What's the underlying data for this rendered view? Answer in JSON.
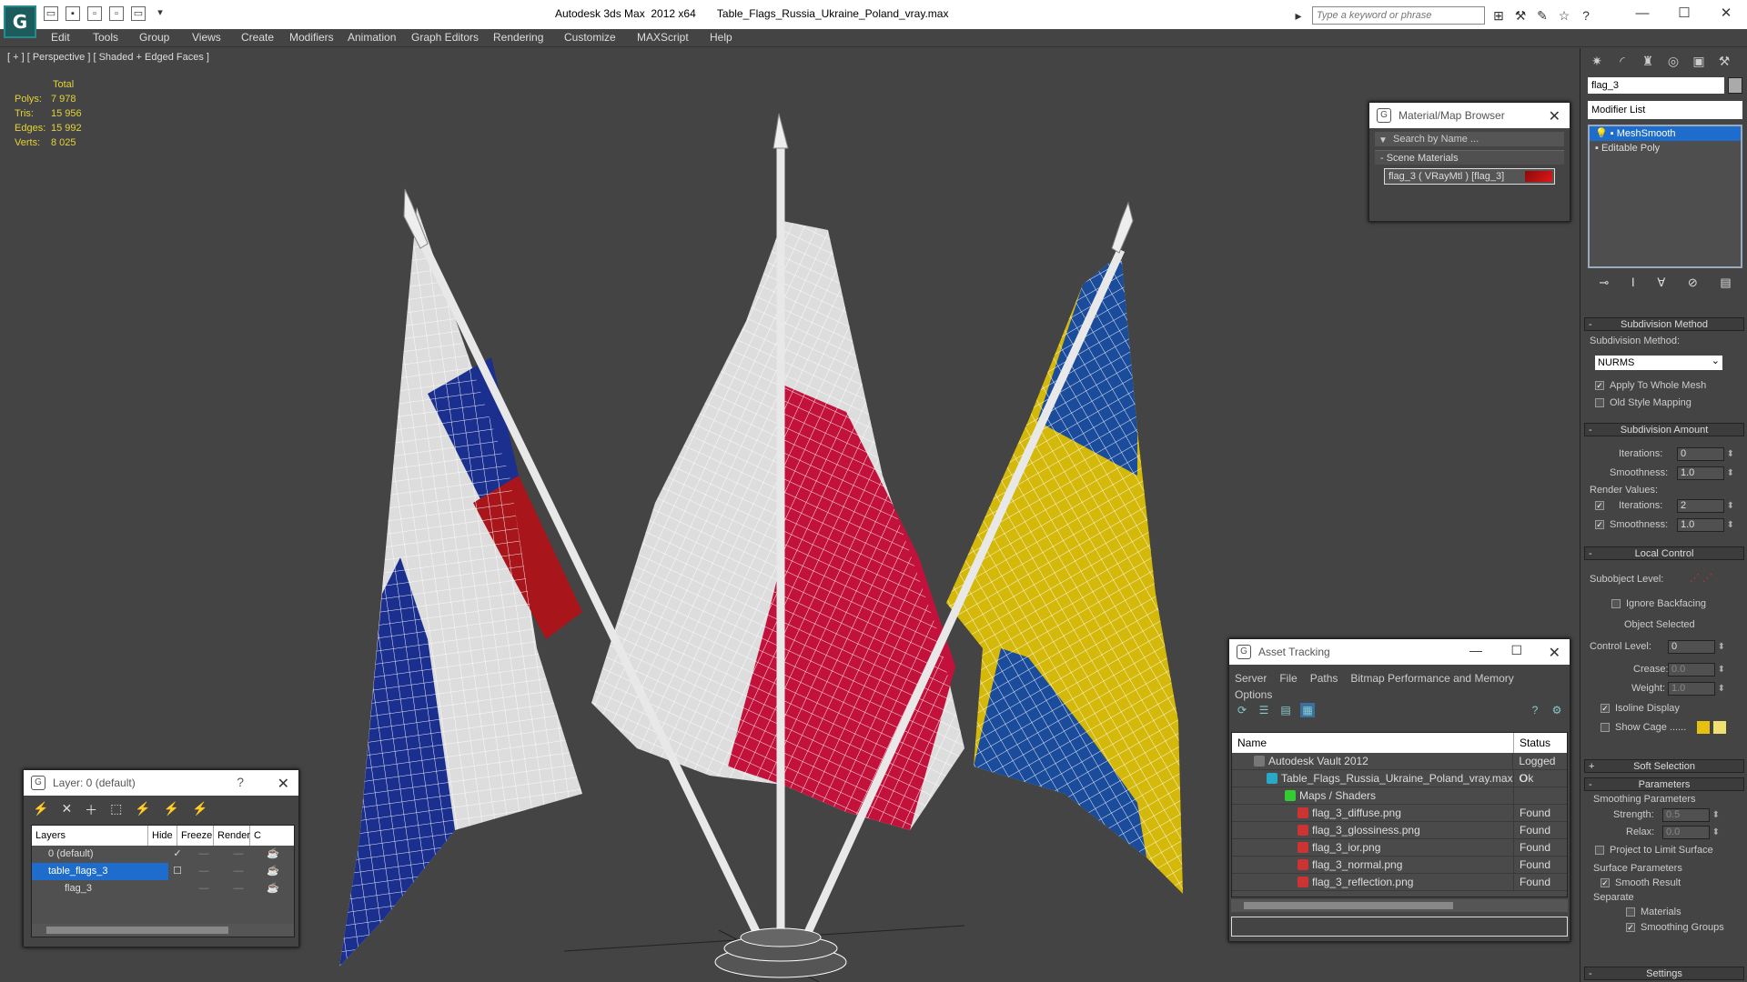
{
  "app": {
    "title": "Autodesk 3ds Max  2012 x64",
    "file": "Table_Flags_Russia_Ukraine_Poland_vray.max"
  },
  "help": {
    "search_placeholder": "Type a keyword or phrase"
  },
  "menu": [
    "Edit",
    "Tools",
    "Group",
    "Views",
    "Create",
    "Modifiers",
    "Animation",
    "Graph Editors",
    "Rendering",
    "Customize",
    "MAXScript",
    "Help"
  ],
  "viewport": {
    "label": "[ + ] [ Perspective ] [ Shaded + Edged Faces ]",
    "stats": {
      "header": "Total",
      "rows": [
        {
          "k": "Polys:",
          "v": "7 978"
        },
        {
          "k": "Tris:",
          "v": "15 956"
        },
        {
          "k": "Edges:",
          "v": "15 992"
        },
        {
          "k": "Verts:",
          "v": "8 025"
        }
      ]
    }
  },
  "material_browser": {
    "title": "Material/Map Browser",
    "search": "Search by Name ...",
    "group": "- Scene Materials",
    "item": "flag_3  ( VRayMtl )  [flag_3]"
  },
  "asset_tracking": {
    "title": "Asset Tracking",
    "menu": [
      "Server",
      "File",
      "Paths",
      "Bitmap Performance and Memory"
    ],
    "menu2": "Options",
    "columns": [
      "Name",
      "Status"
    ],
    "rows": [
      {
        "name": "Autodesk Vault 2012",
        "status": "Logged O",
        "indent": 24,
        "color": "#777"
      },
      {
        "name": "Table_Flags_Russia_Ukraine_Poland_vray.max",
        "status": "Ok",
        "indent": 38,
        "color": "#2aa8c8"
      },
      {
        "name": "Maps / Shaders",
        "status": "",
        "indent": 58,
        "color": "#3c3"
      },
      {
        "name": "flag_3_diffuse.png",
        "status": "Found",
        "indent": 72,
        "color": "#c33"
      },
      {
        "name": "flag_3_glossiness.png",
        "status": "Found",
        "indent": 72,
        "color": "#c33"
      },
      {
        "name": "flag_3_ior.png",
        "status": "Found",
        "indent": 72,
        "color": "#c33"
      },
      {
        "name": "flag_3_normal.png",
        "status": "Found",
        "indent": 72,
        "color": "#c33"
      },
      {
        "name": "flag_3_reflection.png",
        "status": "Found",
        "indent": 72,
        "color": "#c33"
      }
    ]
  },
  "layers": {
    "title": "Layer: 0 (default)",
    "columns": [
      "Layers",
      "Hide",
      "Freeze",
      "Render",
      "C"
    ],
    "rows": [
      {
        "name": "0 (default)",
        "indent": 18,
        "selected": false,
        "check": "✓"
      },
      {
        "name": "table_flags_3",
        "indent": 18,
        "selected": true,
        "check": "☐"
      },
      {
        "name": "flag_3",
        "indent": 36,
        "selected": false,
        "check": ""
      }
    ]
  },
  "command_panel": {
    "object_name": "flag_3",
    "modifier_list": "Modifier List",
    "stack": [
      "MeshSmooth",
      "Editable Poly"
    ],
    "rollouts": {
      "subdivision_method": "Subdivision Method",
      "subdivision_method_label": "Subdivision Method:",
      "method": "NURMS",
      "apply_whole": "Apply To Whole Mesh",
      "old_style": "Old Style Mapping",
      "subdivision_amount": "Subdivision Amount",
      "iterations_label": "Iterations:",
      "iterations": "0",
      "smoothness_label": "Smoothness:",
      "smoothness": "1.0",
      "render_values": "Render Values:",
      "r_iterations": "2",
      "r_smoothness": "1.0",
      "local_control": "Local Control",
      "subobject_level": "Subobject Level:",
      "ignore_backfacing": "Ignore Backfacing",
      "object_selected": "Object Selected",
      "control_level": "Control Level:",
      "control_level_val": "0",
      "crease": "Crease:",
      "crease_val": "0.0",
      "weight": "Weight:",
      "weight_val": "1.0",
      "isoline": "Isoline Display",
      "show_cage": "Show Cage ......",
      "soft_selection": "Soft Selection",
      "parameters": "Parameters",
      "smoothing_params": "Smoothing Parameters",
      "strength": "Strength:",
      "strength_val": "0.5",
      "relax": "Relax:",
      "relax_val": "0.0",
      "project_limit": "Project to Limit Surface",
      "surface_params": "Surface Parameters",
      "smooth_result": "Smooth Result",
      "separate": "Separate",
      "materials": "Materials",
      "smoothing_groups": "Smoothing Groups",
      "settings": "Settings"
    }
  },
  "colors": {
    "russia_blue": "#1b2f8f",
    "russia_red": "#a8161b",
    "poland_red": "#c2123c",
    "ukraine_blue": "#1b4c9c",
    "ukraine_yellow": "#d4b80a"
  }
}
